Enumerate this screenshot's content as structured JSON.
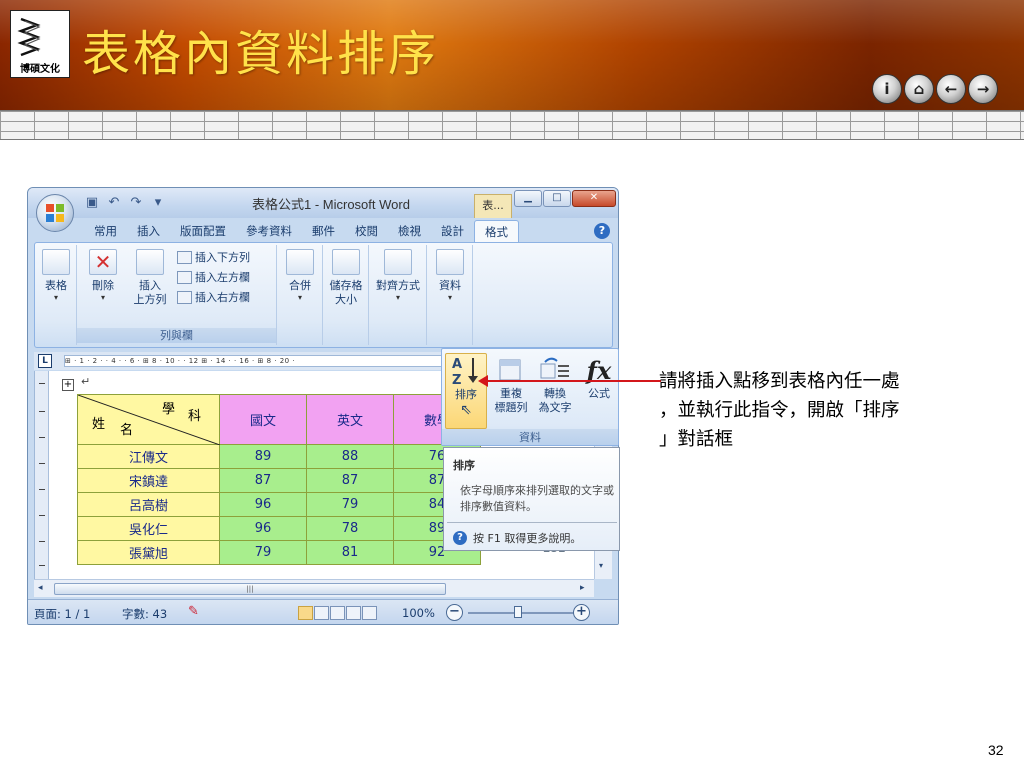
{
  "slide": {
    "title": "表格內資料排序",
    "logo_text": "博碩文化",
    "nav_buttons": [
      "i",
      "⌂",
      "←",
      "→"
    ],
    "page_number": "32",
    "callout_lines": [
      "請將插入點移到表格內任一處",
      "，並執行此指令，開啟「排序",
      "」對話框"
    ],
    "colors": {
      "title": "#ffe24a",
      "callout_line": "#d3161b",
      "header_bg": "#c24a00"
    }
  },
  "word": {
    "window_title": "表格公式1 - Microsoft Word",
    "context_tab": "表...",
    "tabs": [
      "常用",
      "插入",
      "版面配置",
      "參考資料",
      "郵件",
      "校閱",
      "檢視",
      "設計",
      "格式"
    ],
    "active_tab": "格式",
    "ribbon": {
      "table_btn": "表格",
      "delete_btn": "刪除",
      "insert_above_1": "插入",
      "insert_above_2": "上方列",
      "insert_below": "插入下方列",
      "insert_left": "插入左方欄",
      "insert_right": "插入右方欄",
      "rows_cols_group": "列與欄",
      "merge_btn": "合併",
      "cell_size_1": "儲存格",
      "cell_size_2": "大小",
      "alignment_btn": "對齊方式",
      "data_btn": "資料"
    },
    "ruler_text": "⊞ · 1 · 2 · · 4 · · 6 · ⊞ 8 · 10 · · 12 ⊞ · 14 · · 16 · ⊞ 8 · 20 ·",
    "table": {
      "diag_top": "學",
      "diag_top2": "科",
      "diag_bottom1": "姓",
      "diag_bottom2": "名",
      "headers": [
        "國文",
        "英文",
        "數學"
      ],
      "rows": [
        {
          "name": "江傳文",
          "values": [
            "89",
            "88",
            "76"
          ]
        },
        {
          "name": "宋鎮達",
          "values": [
            "87",
            "87",
            "87"
          ]
        },
        {
          "name": "呂高樹",
          "values": [
            "96",
            "79",
            "84"
          ]
        },
        {
          "name": "吳化仁",
          "values": [
            "96",
            "78",
            "89"
          ]
        },
        {
          "name": "張黛旭",
          "values": [
            "79",
            "81",
            "92"
          ]
        }
      ],
      "partial_total": "252"
    },
    "status": {
      "page": "頁面: 1 / 1",
      "words": "字數: 43",
      "zoom": "100%"
    },
    "data_group": {
      "sort": "排序",
      "repeat_1": "重複",
      "repeat_2": "標題列",
      "convert_1": "轉換",
      "convert_2": "為文字",
      "formula": "公式",
      "label": "資料"
    },
    "tooltip": {
      "title": "排序",
      "description": "依字母順序來排列選取的文字或排序數值資料。",
      "help": "按 F1 取得更多說明。"
    }
  }
}
